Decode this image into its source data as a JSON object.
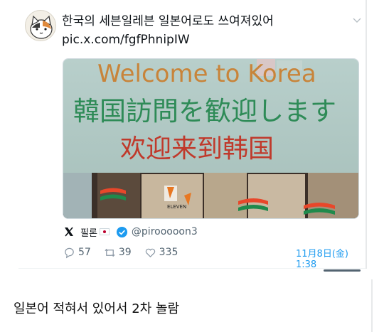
{
  "tweet": {
    "text": "한국의 세븐일레븐 일본어로도 쓰여져있어",
    "link": "pic.x.com/fgfPhnipIW",
    "media": {
      "line_en": "Welcome to Korea",
      "line_jp": "韓国訪問を歓迎します",
      "line_cn": "欢迎来到韩国",
      "store_label": "ELEVEN"
    },
    "author": {
      "name": "필론",
      "handle": "@pirooooon3"
    },
    "stats": {
      "replies": "57",
      "retweets": "39",
      "likes": "335"
    },
    "timestamp": "11月8日(金) 1:38"
  },
  "comment": {
    "text": "일본어 적혀서 있어서 2차 놀람"
  },
  "icons": {
    "menu": "chevron-down-icon",
    "platform": "x-logo-icon",
    "badge": "verified-badge-icon",
    "reply": "reply-icon",
    "retweet": "retweet-icon",
    "like": "heart-icon"
  },
  "colors": {
    "link": "#1d9bf0",
    "muted": "#536471",
    "sign_en": "#c8843a",
    "sign_jp": "#2e8b57",
    "sign_cn": "#c0392b"
  }
}
